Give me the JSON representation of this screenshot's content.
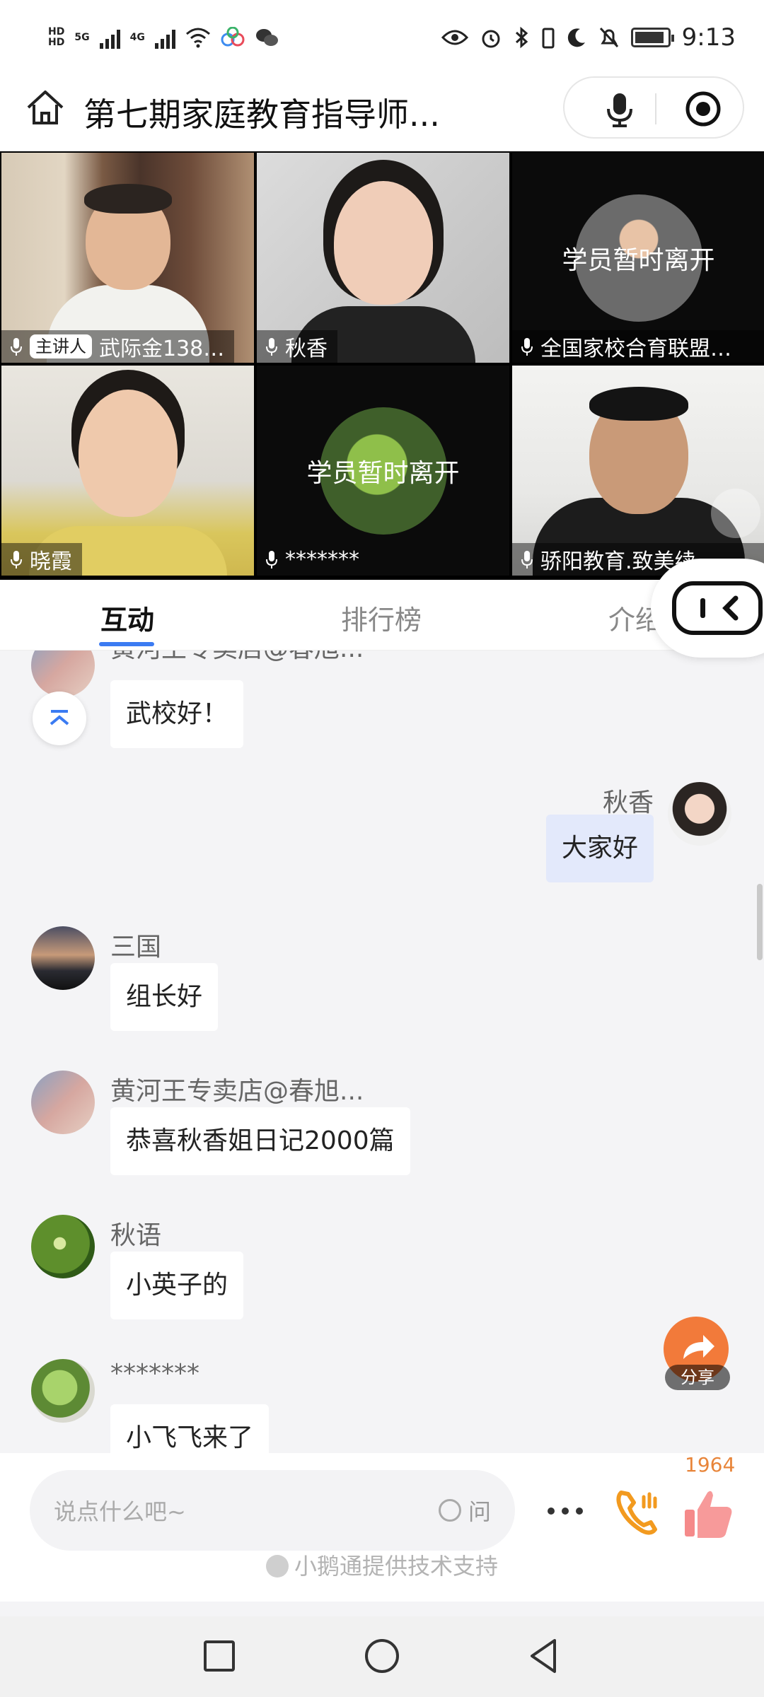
{
  "status_bar": {
    "left_labels": [
      "HD",
      "5G",
      "4G",
      "HD"
    ],
    "time": "9:13"
  },
  "header": {
    "title": "第七期家庭教育指导师...",
    "icons": [
      "home-icon",
      "microphone-icon",
      "record-icon"
    ]
  },
  "video_tiles": [
    {
      "name": "武际金138…",
      "badge": "主讲人",
      "away": false
    },
    {
      "name": "秋香",
      "badge": "",
      "away": false
    },
    {
      "name": "全国家校合育联盟…",
      "badge": "",
      "away": true,
      "away_text": "学员暂时离开"
    },
    {
      "name": "晓霞",
      "badge": "",
      "away": false
    },
    {
      "name": "*******",
      "badge": "",
      "away": true,
      "away_text": "学员暂时离开"
    },
    {
      "name": "骄阳教育.致美续…",
      "badge": "",
      "away": false
    }
  ],
  "tabs": [
    {
      "label": "互动",
      "active": true
    },
    {
      "label": "排行榜",
      "active": false
    },
    {
      "label": "介绍",
      "active": false
    }
  ],
  "messages": [
    {
      "user": "黄河王专卖店@春旭...",
      "text": "武校好！",
      "mine": false
    },
    {
      "user": "秋香",
      "text": "大家好",
      "mine": true
    },
    {
      "user": "三国",
      "text": "组长好",
      "mine": false
    },
    {
      "user": "黄河王专卖店@春旭...",
      "text": "恭喜秋香姐日记2000篇",
      "mine": false
    },
    {
      "user": "秋语",
      "text": "小英子的",
      "mine": false
    },
    {
      "user": "*******",
      "text": "小飞飞来了",
      "mine": false
    }
  ],
  "share": {
    "label": "分享"
  },
  "input": {
    "placeholder": "说点什么吧~",
    "ask_label": "问"
  },
  "like_count": "1964",
  "footer": {
    "text": "小鹅通提供技术支持"
  },
  "colors": {
    "accent": "#3b7bf2",
    "share_orange": "#f27a3a",
    "like_pink": "#f58a8a",
    "my_bubble": "#e3e9fb"
  }
}
